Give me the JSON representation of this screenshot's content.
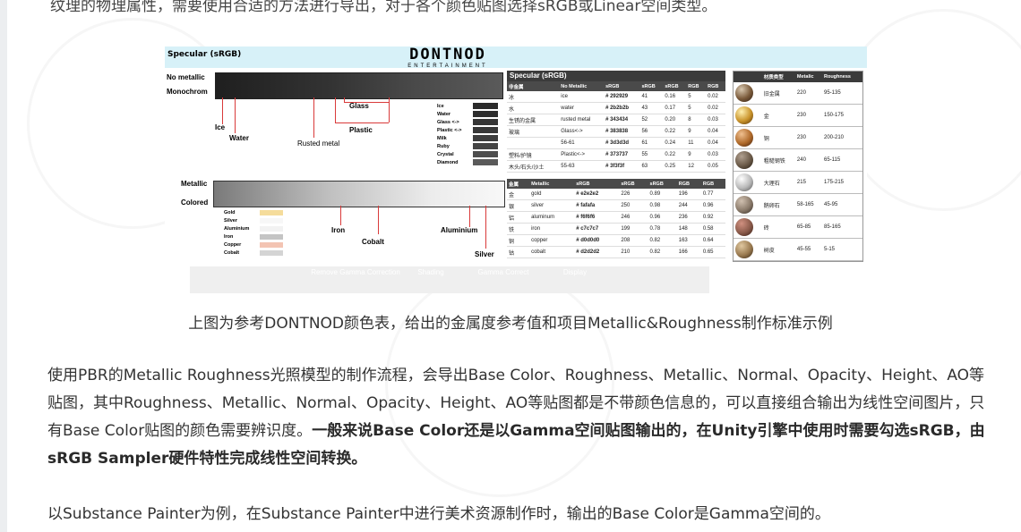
{
  "top_text": "纹理的物理属性，需要使用合适的方法进行导出，对于各个颜色贴图选择sRGB或Linear空间类型。",
  "figure": {
    "header_title": "Specular (sRGB)",
    "logo_main": "DONTNOD",
    "logo_sub": "ENTERTAINMENT",
    "labels": {
      "no_metallic": "No metallic",
      "monochrom": "Monochrom",
      "ice": "Ice",
      "water": "Water",
      "rusted_metal": "Rusted metal",
      "glass": "Glass",
      "plastic": "Plastic",
      "metallic": "Metallic",
      "colored": "Colored",
      "iron": "Iron",
      "cobalt": "Cobalt",
      "aluminium": "Aluminium",
      "silver": "Silver"
    },
    "swatch_legend": [
      "Ice",
      "Water",
      "Glass <->",
      "Plastic <->",
      "Milk",
      "Ruby",
      "Crystal",
      "Diamond"
    ],
    "color_legend": [
      "Gold",
      "Silver",
      "Aluminium",
      "Iron",
      "Copper",
      "Cobalt"
    ],
    "color_legend_colors": [
      "#f5dc9b",
      "#f7f7f7",
      "#f2f2f2",
      "#c4c4c4",
      "#f3c4b3",
      "#d4d4d4"
    ],
    "strip": [
      "Remove Gamma Correction",
      "Shading",
      "Gamma Correct",
      "Display"
    ],
    "table1": {
      "title": "Specular (sRGB)",
      "headers": [
        "非金属",
        "No Metallic",
        "sRGB",
        "sRGB",
        "sRGB",
        "RGB",
        "RGB"
      ],
      "rows": [
        [
          "冰",
          "ice",
          "# 292929",
          "41",
          "0.16",
          "5",
          "0.02"
        ],
        [
          "水",
          "water",
          "# 2b2b2b",
          "43",
          "0.17",
          "5",
          "0.02"
        ],
        [
          "生锈的金属",
          "rusted metal",
          "# 343434",
          "52",
          "0.20",
          "8",
          "0.03"
        ],
        [
          "玻璃",
          "Glass<->",
          "# 383838",
          "56",
          "0.22",
          "9",
          "0.04"
        ],
        [
          "",
          "56-61",
          "# 3d3d3d",
          "61",
          "0.24",
          "11",
          "0.04"
        ],
        [
          "塑料/护镜",
          "Plastic<->",
          "# 373737",
          "55",
          "0.22",
          "9",
          "0.03"
        ],
        [
          "木头/石头/沙土",
          "55-63",
          "# 3f3f3f",
          "63",
          "0.25",
          "12",
          "0.05"
        ]
      ]
    },
    "table2": {
      "headers": [
        "金属",
        "Metallic",
        "sRGB",
        "sRGB",
        "sRGB",
        "RGB",
        "RGB"
      ],
      "rows": [
        [
          "金",
          "gold",
          "# e2e2e2",
          "226",
          "0.89",
          "196",
          "0.77"
        ],
        [
          "银",
          "silver",
          "# fafafa",
          "250",
          "0.98",
          "244",
          "0.96"
        ],
        [
          "铝",
          "aluminum",
          "# f6f6f6",
          "246",
          "0.96",
          "236",
          "0.92"
        ],
        [
          "铁",
          "iron",
          "# c7c7c7",
          "199",
          "0.78",
          "148",
          "0.58"
        ],
        [
          "铜",
          "copper",
          "# d0d0d0",
          "208",
          "0.82",
          "163",
          "0.64"
        ],
        [
          "钴",
          "cobalt",
          "# d2d2d2",
          "210",
          "0.82",
          "166",
          "0.65"
        ]
      ]
    },
    "table3": {
      "headers": [
        "",
        "材质类型",
        "Metalic",
        "Roughness"
      ],
      "rows": [
        [
          "旧金属",
          "220",
          "95-135"
        ],
        [
          "金",
          "230",
          "150-175"
        ],
        [
          "铜",
          "230",
          "200-210"
        ],
        [
          "粗糙钢铁",
          "240",
          "65-115"
        ],
        [
          "大理石",
          "215",
          "175-215"
        ],
        [
          "鹅卵石",
          "58-165",
          "45-95"
        ],
        [
          "砖",
          "65-85",
          "85-165"
        ],
        [
          "树皮",
          "45-55",
          "5-15"
        ]
      ],
      "ball_colors": [
        "#7a5a3a",
        "#c9932a",
        "#b06a2a",
        "#6b5a48",
        "#b8b8b8",
        "#8a7a6a",
        "#8a5a4a",
        "#9a7a50"
      ]
    }
  },
  "caption": "上图为参考DONTNOD颜色表，给出的金属度参考值和项目Metallic&Roughness制作标准示例",
  "paragraph1_normal": "使用PBR的Metallic Roughness光照模型的制作流程，会导出Base Color、Roughness、Metallic、Normal、Opacity、Height、AO等贴图，其中Roughness、Metallic、Normal、Opacity、Height、AO等贴图都是不带颜色信息的，可以直接组合输出为线性空间图片，只有Base Color贴图的颜色需要辨识度。",
  "paragraph1_bold": "一般来说Base Color还是以Gamma空间贴图输出的，在Unity引擎中使用时需要勾选sRGB，由sRGB Sampler硬件特性完成线性空间转换。",
  "paragraph2": "以Substance Painter为例，在Substance Painter中进行美术资源制作时，输出的Base Color是Gamma空间的。"
}
